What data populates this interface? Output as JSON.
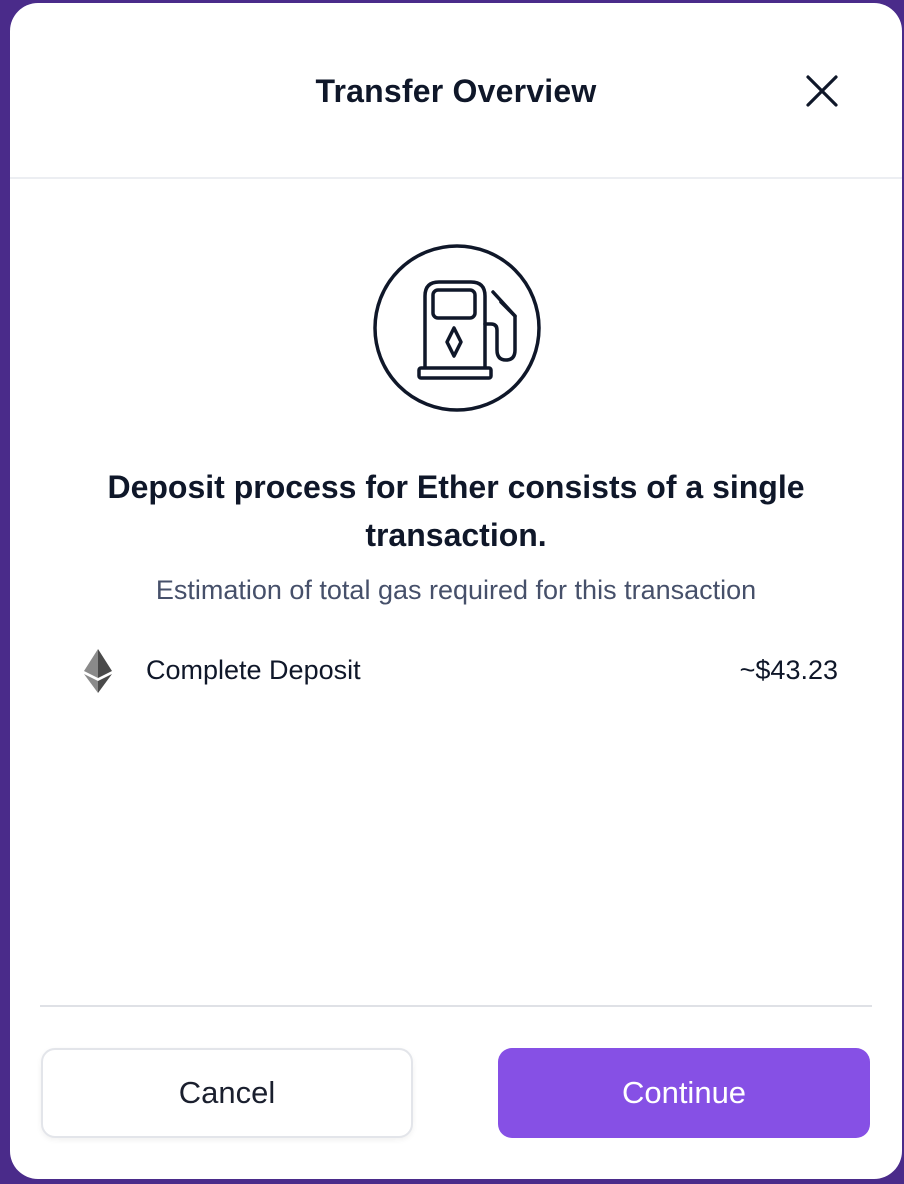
{
  "modal": {
    "title": "Transfer Overview",
    "close_icon": "close-icon",
    "hero_icon": "gas-pump-icon",
    "headline": "Deposit process for Ether consists of a single transaction.",
    "subtitle": "Estimation of total gas required for this transaction",
    "rows": [
      {
        "icon": "ethereum-icon",
        "label": "Complete Deposit",
        "value": "~$43.23"
      }
    ],
    "buttons": {
      "cancel_label": "Cancel",
      "continue_label": "Continue"
    }
  },
  "colors": {
    "backdrop": "#4a2b8a",
    "accent": "#8650e5",
    "text_primary": "#0f1729",
    "text_secondary": "#46506a"
  }
}
